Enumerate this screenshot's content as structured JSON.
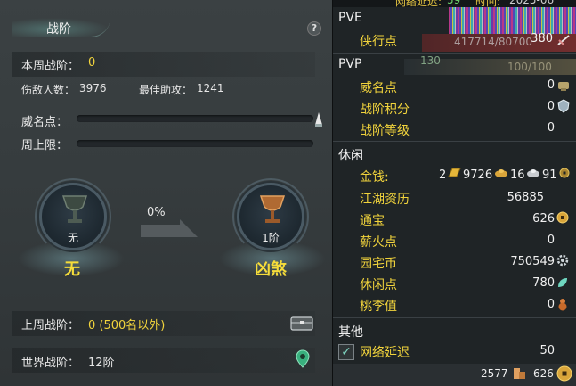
{
  "left": {
    "title": "战阶",
    "help": "?",
    "weekly_label": "本周战阶：",
    "weekly_value": "0",
    "injured_label": "伤敌人数：",
    "injured_value": "3976",
    "assist_label": "最佳助攻：",
    "assist_value": "1241",
    "fame_label": "威名点：",
    "weekly_limit_label": "周上限：",
    "progress_percent": "0%",
    "current_rank": {
      "sub": "无",
      "name": "无"
    },
    "next_rank": {
      "sub": "1阶",
      "name": "凶煞"
    },
    "last_week_label": "上周战阶：",
    "last_week_value": "0 (500名以外)",
    "world_label": "世界战阶：",
    "world_value": "12阶"
  },
  "right": {
    "top_strip": {
      "left_text": "网络延迟:",
      "mid_text": "59",
      "right_text": "时间:",
      "clock": "2025-06"
    },
    "pve_title": "PVE",
    "pve_items": [
      {
        "label": "侠行点",
        "value": "380"
      }
    ],
    "pve_overlay": "417714/80700",
    "pvp_title": "PVP",
    "pvp_overlay_left": "130",
    "pvp_overlay_right": "100/100",
    "pvp_items": [
      {
        "label": "威名点",
        "value": "0"
      },
      {
        "label": "战阶积分",
        "value": "0"
      },
      {
        "label": "战阶等级",
        "value": "0"
      }
    ],
    "leisure_title": "休闲",
    "money": {
      "label": "金钱:",
      "v1": "2",
      "v2": "9726",
      "v3": "16",
      "v4": "91"
    },
    "leisure_items": [
      {
        "label": "江湖资历",
        "value": "56885"
      },
      {
        "label": "通宝",
        "value": "626"
      },
      {
        "label": "薪火点",
        "value": "0"
      },
      {
        "label": "园宅币",
        "value": "750549"
      },
      {
        "label": "休闲点",
        "value": "780"
      },
      {
        "label": "桃李值",
        "value": "0"
      }
    ],
    "other_title": "其他",
    "net_delay": {
      "label": "网络延迟",
      "value": "50",
      "checked": true
    },
    "footer": {
      "left_value": "2577",
      "right_value": "626"
    }
  }
}
